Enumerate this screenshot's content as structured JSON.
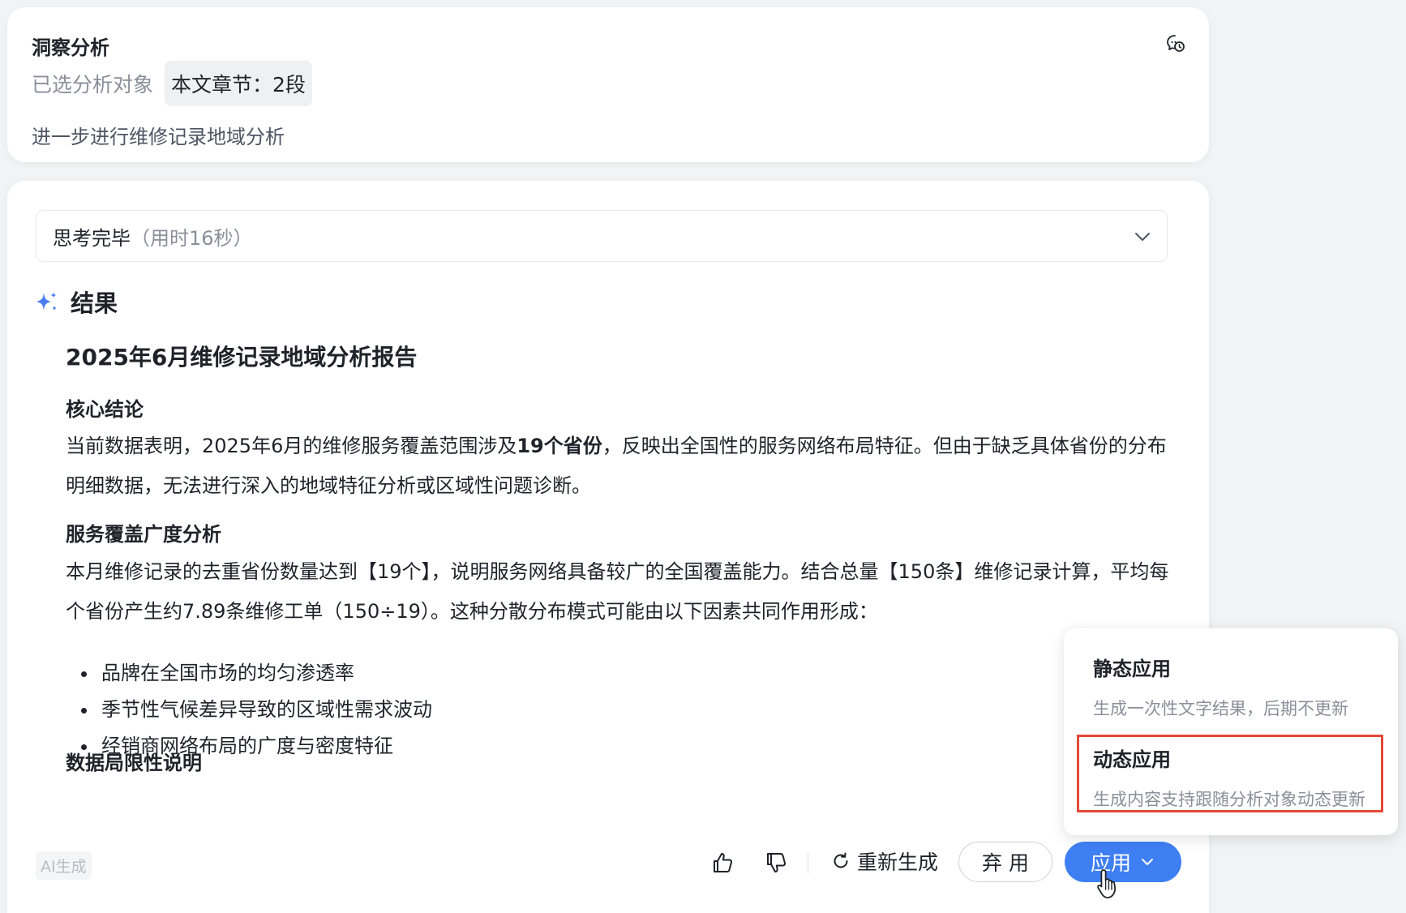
{
  "insight": {
    "title": "洞察分析",
    "selected_label": "已选分析对象",
    "selected_chip": "本文章节：2段",
    "query": "进一步进行维修记录地域分析"
  },
  "thinking": {
    "status": "思考完毕",
    "duration": "（用时16秒）"
  },
  "result": {
    "label": "结果",
    "report_title": "2025年6月维修记录地域分析报告",
    "section1_title": "核心结论",
    "section1_p_a": "当前数据表明，2025年6月的维修服务覆盖范围涉及",
    "section1_p_bold": "19个省份",
    "section1_p_b": "，反映出全国性的服务网络布局特征。但由于缺乏具体省份的分布明细数据，无法进行深入的地域特征分析或区域性问题诊断。",
    "section2_title": "服务覆盖广度分析",
    "section2_p": "本月维修记录的去重省份数量达到【19个】，说明服务网络具备较广的全国覆盖能力。结合总量【150条】维修记录计算，平均每个省份产生约7.89条维修工单（150÷19）。这种分散分布模式可能由以下因素共同作用形成：",
    "bullets": [
      "品牌在全国市场的均匀渗透率",
      "季节性气候差异导致的区域性需求波动",
      "经销商网络布局的广度与密度特征"
    ],
    "section3_title": "数据局限性说明"
  },
  "footer": {
    "ai_badge": "AI生成",
    "regenerate": "重新生成",
    "discard": "弃用",
    "apply": "应用"
  },
  "apply_menu": {
    "items": [
      {
        "title": "静态应用",
        "desc": "生成一次性文字结果，后期不更新"
      },
      {
        "title": "动态应用",
        "desc": "生成内容支持跟随分析对象动态更新"
      }
    ]
  },
  "colors": {
    "primary": "#3f7ff4",
    "highlight": "#e5483a",
    "sparkle": "#4a7cf0"
  }
}
